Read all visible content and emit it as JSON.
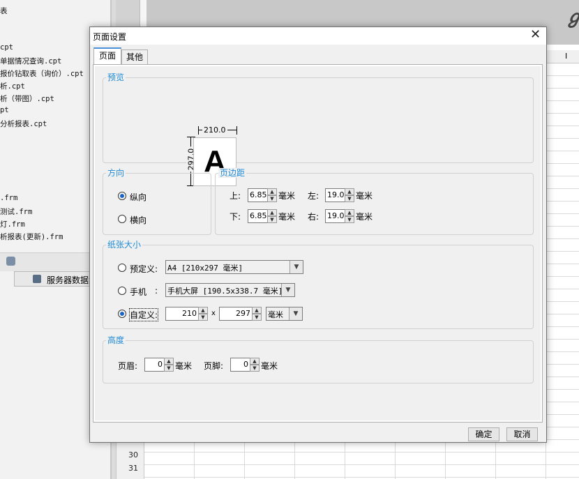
{
  "background": {
    "file_list": [
      "表",
      "cpt",
      "单据情况查询.cpt",
      "报价钻取表（询价）.cpt",
      "析.cpt",
      "析（带图）.cpt",
      "pt",
      "分析报表.cpt",
      ".frm",
      "测试.frm",
      "灯.frm",
      "析报表(更新).frm"
    ],
    "server_data_label": "服务器数据集",
    "column_header_i": "I",
    "row_numbers": [
      "30",
      "31"
    ]
  },
  "dialog": {
    "title": "页面设置",
    "close_glyph": "✕",
    "tabs": [
      "页面",
      "其他"
    ],
    "preview": {
      "title": "预览",
      "width_label": "210.0",
      "height_label": "297.0",
      "letter": "A"
    },
    "orientation": {
      "title": "方向",
      "portrait_label": "纵向",
      "landscape_label": "横向",
      "selected": "纵向"
    },
    "margins": {
      "title": "页边距",
      "top_label": "上:",
      "top_value": "6.85",
      "left_label": "左:",
      "left_value": "19.05",
      "bottom_label": "下:",
      "bottom_value": "6.85",
      "right_label": "右:",
      "right_value": "19.05",
      "unit": "毫米"
    },
    "paper_size": {
      "title": "纸张大小",
      "predefined_label": "预定义:",
      "predefined_value": "A4 [210x297 毫米]",
      "mobile_label": "手机",
      "mobile_colon": ":",
      "mobile_value": "手机大屏 [190.5x338.7 毫米]",
      "custom_label": "自定义:",
      "custom_width": "210",
      "times": "x",
      "custom_height": "297",
      "custom_unit": "毫米",
      "selected": "自定义"
    },
    "height": {
      "title": "高度",
      "header_label": "页眉:",
      "header_value": "0",
      "footer_label": "页脚:",
      "footer_value": "0",
      "unit": "毫米"
    },
    "buttons": {
      "ok": "确定",
      "cancel": "取消"
    }
  }
}
